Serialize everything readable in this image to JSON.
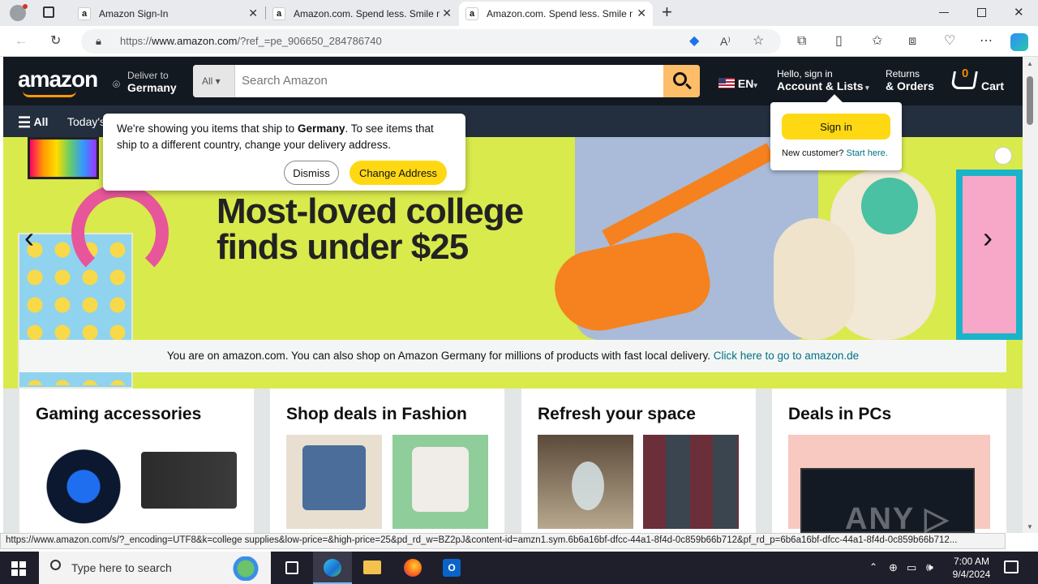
{
  "browser": {
    "tabs": [
      {
        "title": "Amazon Sign-In",
        "favicon": "a"
      },
      {
        "title": "Amazon.com. Spend less. Smile m",
        "favicon": "a"
      },
      {
        "title": "Amazon.com. Spend less. Smile m",
        "favicon": "a"
      }
    ],
    "url_prefix": "https://",
    "url_host": "www.amazon.com",
    "url_path": "/?ref_=pe_906650_284786740",
    "new_tab": "+"
  },
  "nav": {
    "logo": "amazon",
    "deliver_to": "Deliver to",
    "country": "Germany",
    "search_category": "All",
    "search_placeholder": "Search Amazon",
    "lang": "EN",
    "hello": "Hello, sign in",
    "account": "Account & Lists",
    "returns": "Returns",
    "orders": "& Orders",
    "cart_count": "0",
    "cart": "Cart"
  },
  "subnav": {
    "all": "All",
    "todays": "Today's"
  },
  "ship_popup": {
    "text_a": "We're showing you items that ship to ",
    "country": "Germany",
    "text_b": ". To see items that ship to a different country, change your delivery address.",
    "dismiss": "Dismiss",
    "change": "Change Address"
  },
  "signin_popup": {
    "button": "Sign in",
    "new_customer": "New customer?",
    "start_here": "Start here."
  },
  "hero": {
    "headline_1": "Most-loved college",
    "headline_2": "finds under $25",
    "notice": "You are on amazon.com. You can also shop on Amazon Germany for millions of products with fast local delivery.",
    "notice_link": "Click here to go to amazon.de"
  },
  "cards": [
    {
      "title": "Gaming accessories"
    },
    {
      "title": "Shop deals in Fashion"
    },
    {
      "title": "Refresh your space"
    },
    {
      "title": "Deals in PCs"
    }
  ],
  "status_url": "https://www.amazon.com/s/?_encoding=UTF8&k=college supplies&low-price=&high-price=25&pd_rd_w=BZ2pJ&content-id=amzn1.sym.6b6a16bf-dfcc-44a1-8f4d-0c859b66b712&pf_rd_p=6b6a16bf-dfcc-44a1-8f4d-0c859b66b712...",
  "taskbar": {
    "search_placeholder": "Type here to search",
    "time": "7:00 AM",
    "date": "9/4/2024"
  },
  "colors": {
    "nav_bg": "#131921",
    "subnav_bg": "#232f3e",
    "search_button": "#febd69",
    "accent_yellow": "#ffd814",
    "link": "#007185",
    "hero_bg": "#d9ea4c"
  }
}
